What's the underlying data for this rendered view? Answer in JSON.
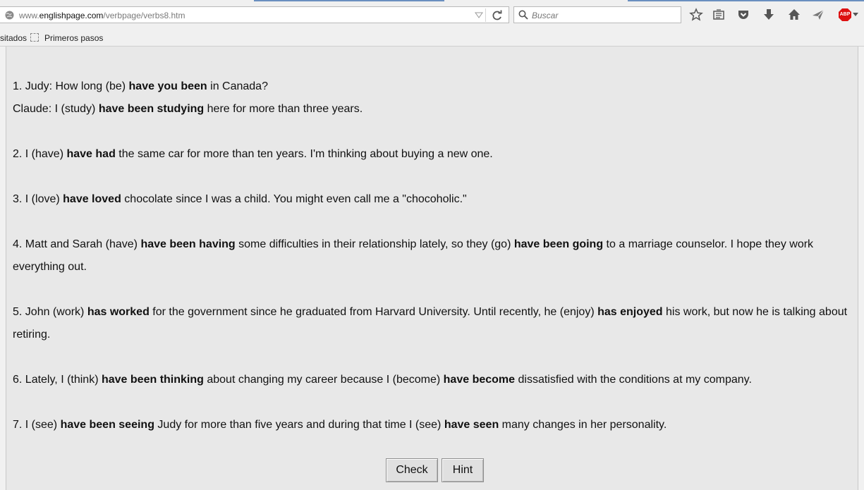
{
  "browser": {
    "url_prefix": "www.",
    "url_host": "englishpage.com",
    "url_path": "/verbpage/verbs8.htm",
    "search_placeholder": "Buscar",
    "bookmarks_partial": "sitados",
    "bookmark_item": "Primeros pasos",
    "toolbar_icons": [
      "star-icon",
      "reading-list-icon",
      "pocket-icon",
      "download-icon",
      "home-icon",
      "share-icon",
      "adblock-icon"
    ],
    "adblock_label": "ABP"
  },
  "exercise": {
    "q1": {
      "n": "1.",
      "a": " Judy: How long (be) ",
      "ans1": "have you been",
      "b": " in Canada?",
      "c": "Claude: I (study) ",
      "ans2": "have been studying",
      "d": " here for more than three years."
    },
    "q2": {
      "a": "2. I (have) ",
      "ans1": "have had",
      "b": " the same car for more than ten years. I'm thinking about buying a new one."
    },
    "q3": {
      "a": "3. I (love) ",
      "ans1": "have loved",
      "b": " chocolate since I was a child. You might even call me a \"chocoholic.\""
    },
    "q4": {
      "a": "4. Matt and Sarah (have) ",
      "ans1": "have been having",
      "b": " some difficulties in their relationship lately, so they (go) ",
      "ans2": "have been going",
      "c": " to a marriage counselor. I hope they work everything out."
    },
    "q5": {
      "a": "5. John (work) ",
      "ans1": "has worked",
      "b": " for the government since he graduated from Harvard University. Until recently, he (enjoy) ",
      "ans2": "has enjoyed",
      "c": " his work, but now he is talking about retiring."
    },
    "q6": {
      "a": "6. Lately, I (think) ",
      "ans1": "have been thinking",
      "b": " about changing my career because I (become) ",
      "ans2": "have become",
      "c": " dissatisfied with the conditions at my company."
    },
    "q7": {
      "a": "7. I (see) ",
      "ans1": "have been seeing",
      "b": " Judy for more than five years and during that time I (see) ",
      "ans2": "have seen",
      "c": " many changes in her personality."
    },
    "check_label": "Check",
    "hint_label": "Hint"
  }
}
